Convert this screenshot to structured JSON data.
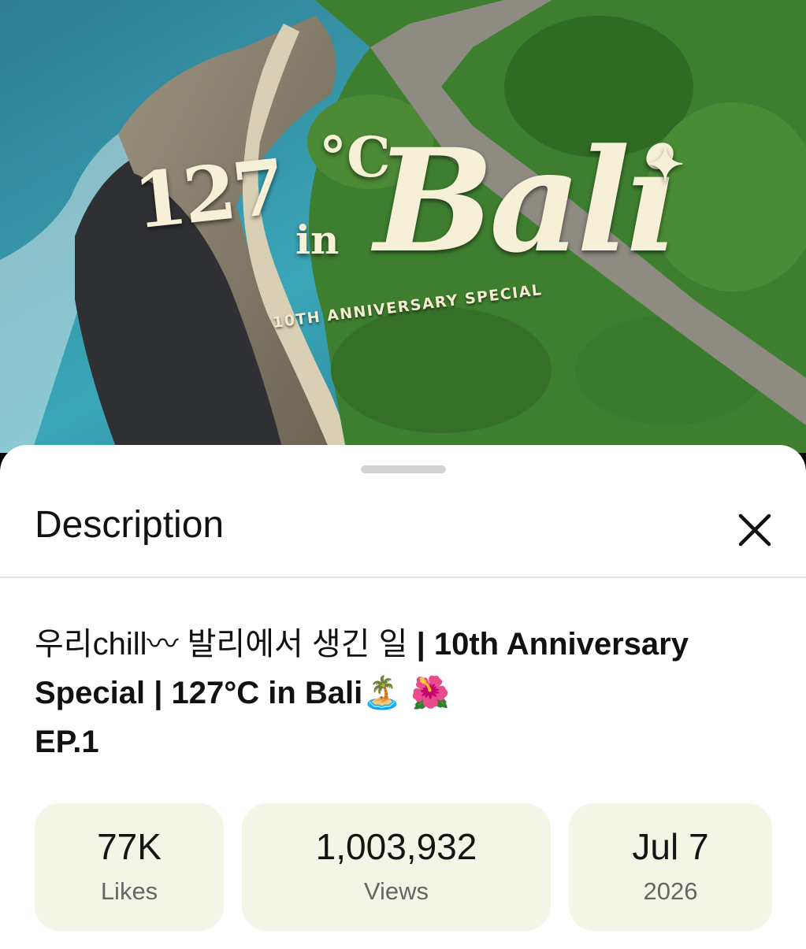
{
  "video": {
    "overlay_title_number": "127",
    "overlay_title_degree": "°C",
    "overlay_title_in": "in",
    "overlay_title_place": "Bali",
    "overlay_subtitle": "10TH ANNIVERSARY SPECIAL"
  },
  "sheet": {
    "title": "Description",
    "close_icon": "close-icon"
  },
  "video_title": {
    "korean": "우리chill〰 발리에서 생긴 일",
    "english": " | 10th Anniversary Special | 127°C in Bali",
    "emojis": "🏝️ 🌺",
    "episode": "EP.1"
  },
  "stats": [
    {
      "value": "77K",
      "label": "Likes"
    },
    {
      "value": "1,003,932",
      "label": "Views"
    },
    {
      "value": "Jul 7",
      "label": "2026"
    }
  ],
  "colors": {
    "stat_background": "#f3f6e6",
    "sheet_background": "#ffffff",
    "title_overlay": "#f6f0d6"
  }
}
